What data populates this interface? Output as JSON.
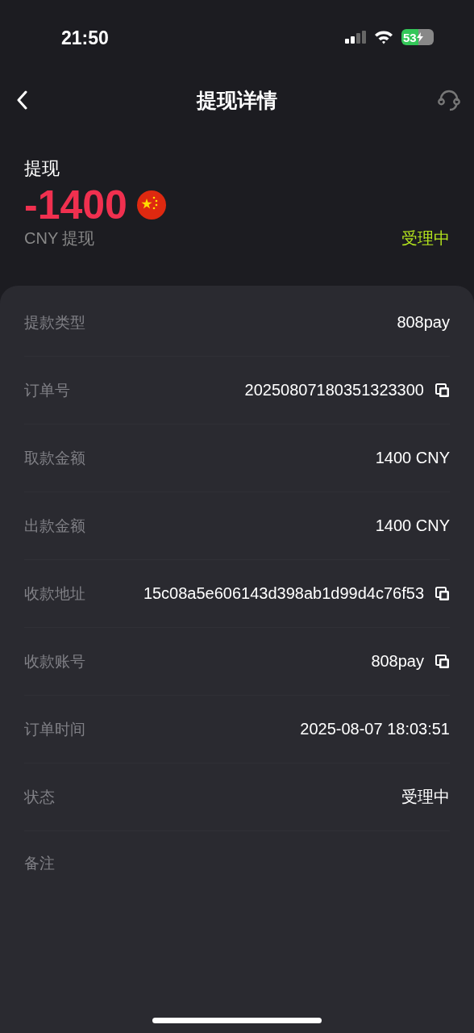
{
  "status_bar": {
    "time": "21:50",
    "battery": "53",
    "charging": true
  },
  "header": {
    "title": "提现详情"
  },
  "summary": {
    "label": "提现",
    "amount": "-1400",
    "subtitle": "CNY 提现",
    "status": "受理中"
  },
  "details": [
    {
      "label": "提款类型",
      "value": "808pay",
      "copyable": false
    },
    {
      "label": "订单号",
      "value": "20250807180351323300",
      "copyable": true
    },
    {
      "label": "取款金额",
      "value": "1400 CNY",
      "copyable": false
    },
    {
      "label": "出款金额",
      "value": "1400 CNY",
      "copyable": false
    },
    {
      "label": "收款地址",
      "value": "15c08a5e606143d398ab1d99d4c76f53",
      "copyable": true
    },
    {
      "label": "收款账号",
      "value": "808pay",
      "copyable": true
    },
    {
      "label": "订单时间",
      "value": "2025-08-07 18:03:51",
      "copyable": false
    },
    {
      "label": "状态",
      "value": "受理中",
      "copyable": false
    },
    {
      "label": "备注",
      "copyable": false
    }
  ]
}
